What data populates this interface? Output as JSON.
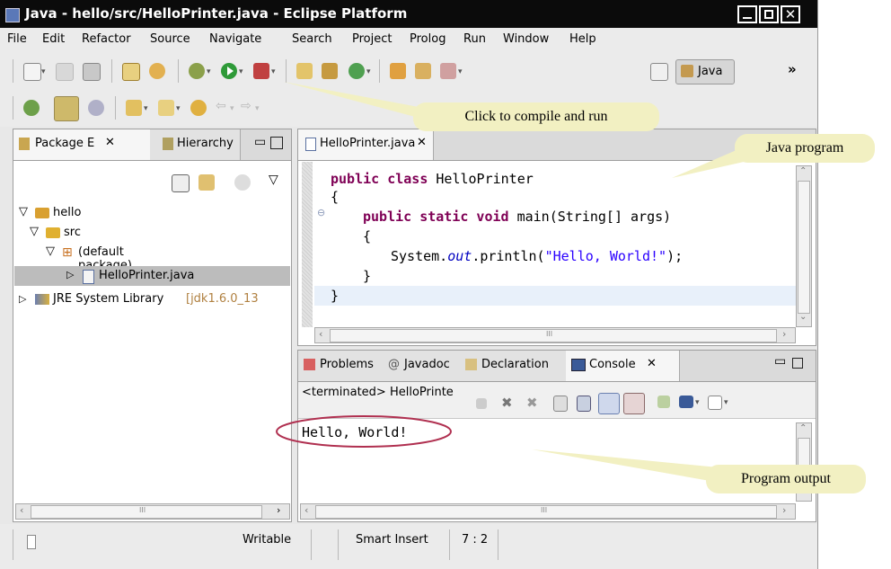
{
  "window": {
    "title": "Java - hello/src/HelloPrinter.java - Eclipse Platform"
  },
  "menu": [
    "File",
    "Edit",
    "Refactor",
    "Source",
    "Navigate",
    "Search",
    "Project",
    "Prolog",
    "Run",
    "Window",
    "Help"
  ],
  "toolbar": {
    "perspective_label": "Java",
    "overflow": "»"
  },
  "left_panel": {
    "tabs": [
      "Package E",
      "Hierarchy"
    ],
    "tree": [
      {
        "label": "hello",
        "icon": "project-folder-icon"
      },
      {
        "label": "src",
        "icon": "source-folder-icon"
      },
      {
        "label": "(default package)",
        "icon": "package-icon"
      },
      {
        "label": "HelloPrinter.java",
        "icon": "java-file-icon",
        "selected": true
      },
      {
        "label": "JRE System Library",
        "suffix": "[jdk1.6.0_13",
        "icon": "library-icon"
      }
    ],
    "scroll_mark": "III"
  },
  "editor": {
    "tab": "HelloPrinter.java",
    "lines": [
      {
        "kw": "public class",
        "text": " HelloPrinter"
      },
      {
        "text": "{"
      },
      {
        "kw": "public static void",
        "text": " main(String[] args)"
      },
      {
        "text": "{"
      },
      {
        "pre": "System.",
        "italic": "out",
        "post": ".println(",
        "str": "\"Hello, World!\"",
        "end": ");"
      },
      {
        "text": "}"
      },
      {
        "text": "}"
      }
    ],
    "scroll_mark": "III"
  },
  "bottom_panel": {
    "tabs": [
      "Problems",
      "Javadoc",
      "Declaration",
      "Console"
    ],
    "status": "<terminated> HelloPrinte",
    "output": "Hello, World!",
    "scroll_mark": "III"
  },
  "statusbar": {
    "writable": "Writable",
    "insert_mode": "Smart Insert",
    "position": "7 : 2"
  },
  "callouts": {
    "compile": "Click to compile and run",
    "program": "Java program",
    "output": "Program output"
  },
  "colors": {
    "keyword": "#7f0055",
    "string": "#2a00ff",
    "field": "#0000c0",
    "callout": "#f2f0c2",
    "highlight_circle": "#b03050"
  }
}
